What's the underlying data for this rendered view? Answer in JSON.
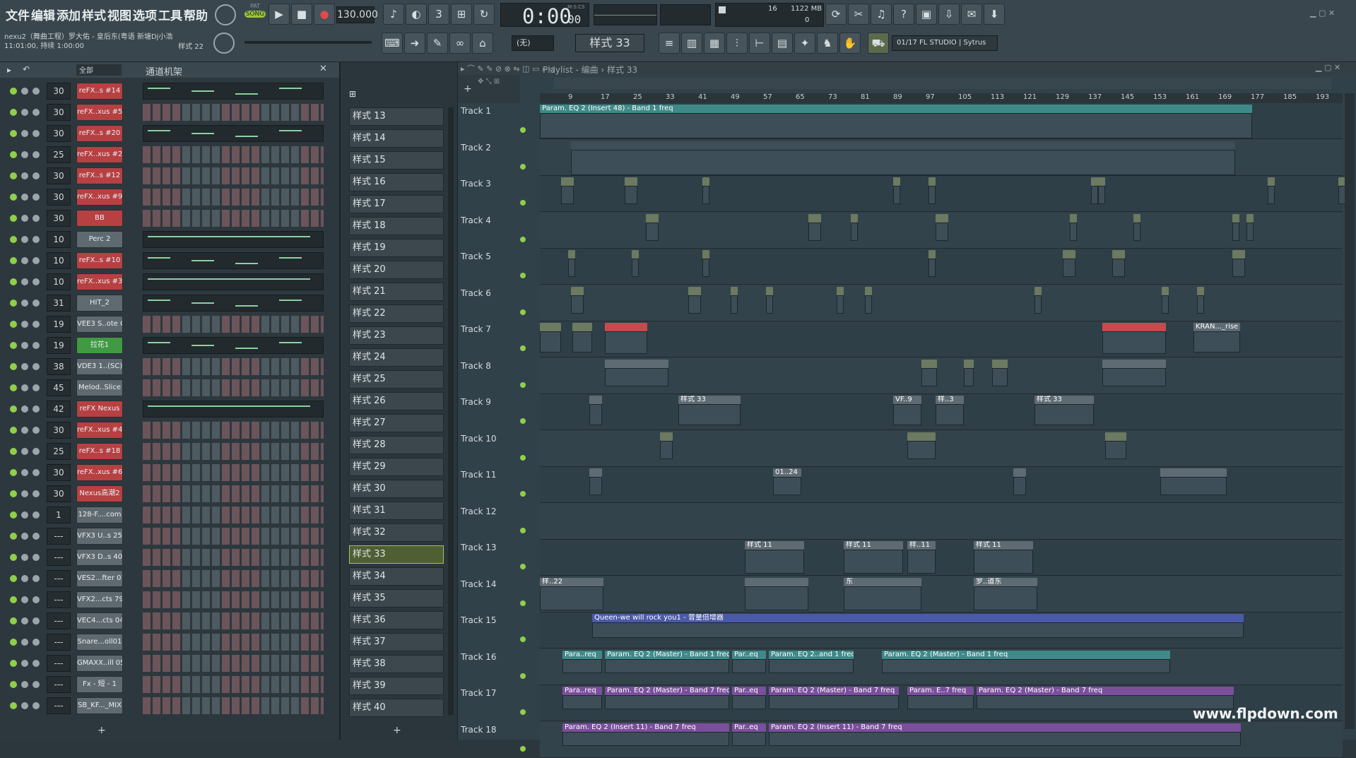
{
  "menu": [
    "文件",
    "编辑",
    "添加",
    "样式",
    "视图",
    "选项",
    "工具",
    "帮助"
  ],
  "transport": {
    "mode": "SONG",
    "pat_label": "PAT",
    "tempo": "130.000",
    "time": "0:00",
    "time_small": "00",
    "time_unit": "M:S:CS"
  },
  "monitor": {
    "voices": "16",
    "memory": "1122 MB",
    "cpu": "0"
  },
  "project": {
    "title": "nexu2（舞曲工程）罗大佑 - 皇后东(粤语 新塘Dj小浩",
    "line2": "11:01:00, 持续 1:00:00",
    "pattern": "样式 22"
  },
  "toolbar2": {
    "snap": "(无)",
    "current_pattern": "样式 33",
    "news": "01/17  FL STUDIO | Sytrus"
  },
  "channel_rack": {
    "filter": "全部",
    "title": "通道机架",
    "channels": [
      {
        "vol": "30",
        "name": "reFX..s #14",
        "color": "red"
      },
      {
        "vol": "30",
        "name": "reFX..xus #5",
        "color": "red"
      },
      {
        "vol": "30",
        "name": "reFX..s #20",
        "color": "red"
      },
      {
        "vol": "25",
        "name": "reFX..xus #2",
        "color": "red"
      },
      {
        "vol": "30",
        "name": "reFX..s #12",
        "color": "red"
      },
      {
        "vol": "30",
        "name": "reFX..xus #9",
        "color": "red"
      },
      {
        "vol": "30",
        "name": "BB",
        "color": "red"
      },
      {
        "vol": "10",
        "name": "Perc 2",
        "color": "gray"
      },
      {
        "vol": "10",
        "name": "reFX..s #10",
        "color": "red"
      },
      {
        "vol": "10",
        "name": "reFX..xus #3",
        "color": "red"
      },
      {
        "vol": "31",
        "name": "HIT_2",
        "color": "gray"
      },
      {
        "vol": "19",
        "name": "VEE3 S..ote C",
        "color": "gray"
      },
      {
        "vol": "19",
        "name": "拉花1",
        "color": "green"
      },
      {
        "vol": "38",
        "name": "VDE3 1..(SC)",
        "color": "gray"
      },
      {
        "vol": "45",
        "name": "Melod..Slice",
        "color": "gray"
      },
      {
        "vol": "42",
        "name": "reFX Nexus",
        "color": "red"
      },
      {
        "vol": "30",
        "name": "reFX..xus #4",
        "color": "red"
      },
      {
        "vol": "25",
        "name": "reFX..s #18",
        "color": "red"
      },
      {
        "vol": "30",
        "name": "reFX..xus #6",
        "color": "red"
      },
      {
        "vol": "30",
        "name": "Nexus高潮2",
        "color": "red"
      },
      {
        "vol": "1",
        "name": "128-F....com",
        "color": "gray"
      },
      {
        "vol": "---",
        "name": "VFX3 U..s 25",
        "color": "gray"
      },
      {
        "vol": "---",
        "name": "VFX3 D..s 40",
        "color": "gray"
      },
      {
        "vol": "---",
        "name": "VES2...fter 01",
        "color": "gray"
      },
      {
        "vol": "---",
        "name": "VFX2...cts 79",
        "color": "gray"
      },
      {
        "vol": "---",
        "name": "VEC4...cts 04",
        "color": "gray"
      },
      {
        "vol": "---",
        "name": "Snare...oll01",
        "color": "gray"
      },
      {
        "vol": "---",
        "name": "GMAXX..ill 05",
        "color": "gray"
      },
      {
        "vol": "---",
        "name": "Fx - 短 - 1",
        "color": "gray"
      },
      {
        "vol": "---",
        "name": "SB_KF..._MIX",
        "color": "gray"
      }
    ]
  },
  "patterns": [
    "样式 13",
    "样式 14",
    "样式 15",
    "样式 16",
    "样式 17",
    "样式 18",
    "样式 19",
    "样式 20",
    "样式 21",
    "样式 22",
    "样式 23",
    "样式 24",
    "样式 25",
    "样式 26",
    "样式 27",
    "样式 28",
    "样式 29",
    "样式 30",
    "样式 31",
    "样式 32",
    "样式 33",
    "样式 34",
    "样式 35",
    "样式 36",
    "样式 37",
    "样式 38",
    "样式 39",
    "样式 40"
  ],
  "selected_pattern_index": 20,
  "playlist": {
    "title": "Playlist - 编曲 › 样式 33",
    "ruler": [
      "9",
      "17",
      "25",
      "33",
      "41",
      "49",
      "57",
      "65",
      "73",
      "81",
      "89",
      "97",
      "105",
      "113",
      "121",
      "129",
      "137",
      "145",
      "153",
      "161",
      "169",
      "177",
      "185",
      "193"
    ],
    "tracks": [
      "Track 1",
      "Track 2",
      "Track 3",
      "Track 4",
      "Track 5",
      "Track 6",
      "Track 7",
      "Track 8",
      "Track 9",
      "Track 10",
      "Track 11",
      "Track 12",
      "Track 13",
      "Track 14",
      "Track 15",
      "Track 16",
      "Track 17",
      "Track 18"
    ],
    "clips": {
      "t1": "Param. EQ 2 (Insert 48) - Band 1 freq",
      "t9a": "样式 33",
      "t9b": "VF..9",
      "t9c": "样..3",
      "t9d": "样式 33",
      "t11": "01..24",
      "t7a": "KRAN..._rise",
      "t13a": "样式 11",
      "t13b": "样式 11",
      "t13c": "样..11",
      "t13d": "样式 11",
      "t14a": "样..22",
      "t14b": "东",
      "t14c": "罗..道东",
      "t15": "Queen-we will rock you1 - 音量倍增器",
      "t16a": "Para..req",
      "t16b": "Param. EQ 2 (Master) - Band 1 freq",
      "t16c": "Par..eq",
      "t16d": "Param. EQ 2..and 1 freq",
      "t16e": "Param. EQ 2 (Master) - Band 1 freq",
      "t17a": "Para..req",
      "t17b": "Param. EQ 2 (Master) - Band 7 freq",
      "t17c": "Par..eq",
      "t17d": "Param. EQ 2 (Master) - Band 7 freq",
      "t17e": "Param. E..7 freq",
      "t17f": "Param. EQ 2 (Master) - Band 7 freq",
      "t18a": "Param. EQ 2 (Insert 11) - Band 7 freq",
      "t18b": "Par..eq",
      "t18c": "Param. EQ 2 (Insert 11) - Band 7 freq"
    }
  },
  "watermark": "www.flpdown.com",
  "colors": {
    "accent_red": "#b74042",
    "accent_green": "#3f9a42",
    "clip_teal": "#3e8a88",
    "clip_purple": "#7a4f9c",
    "clip_blue": "#4a5aa8",
    "audio_pink": "#e98c93"
  }
}
